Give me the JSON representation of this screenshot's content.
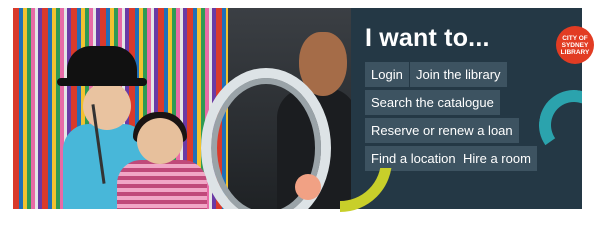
{
  "panel": {
    "title": "I want to...",
    "links": [
      {
        "label": "Login"
      },
      {
        "label": "Join the library"
      },
      {
        "label": "Search the catalogue"
      },
      {
        "label": "Reserve or renew a loan"
      },
      {
        "label": "Find a location"
      },
      {
        "label": "Hire a room"
      }
    ]
  },
  "logo": {
    "line1": "CITY OF",
    "line2": "SYDNEY",
    "line3": "LIBRARY"
  },
  "colors": {
    "panel_bg": "#243845",
    "button_bg": "#3d5361",
    "logo_red": "#e23c23",
    "teal": "#2ba3ad",
    "lime": "#c8cf2a",
    "peach": "#f1a184"
  },
  "photo": {
    "subject": "photo-booth-image"
  }
}
